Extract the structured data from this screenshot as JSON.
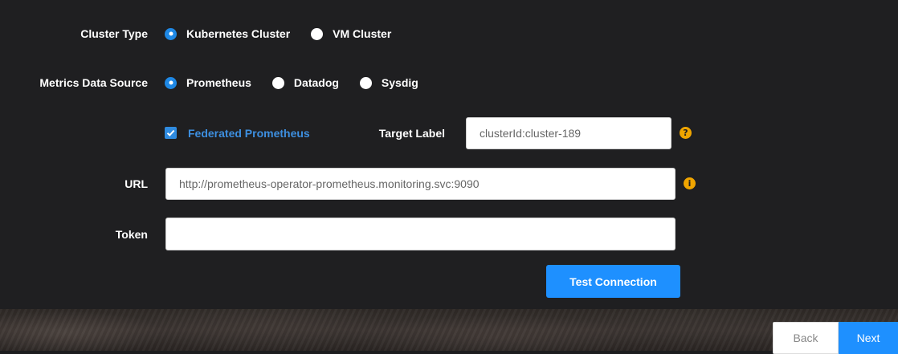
{
  "form": {
    "cluster_type": {
      "label": "Cluster Type",
      "options": [
        {
          "label": "Kubernetes Cluster",
          "selected": true
        },
        {
          "label": "VM Cluster",
          "selected": false
        }
      ]
    },
    "metrics_source": {
      "label": "Metrics Data Source",
      "options": [
        {
          "label": "Prometheus",
          "selected": true
        },
        {
          "label": "Datadog",
          "selected": false
        },
        {
          "label": "Sysdig",
          "selected": false
        }
      ]
    },
    "federated": {
      "label": "Federated Prometheus",
      "checked": true
    },
    "target_label": {
      "label": "Target Label",
      "value": "clusterId:cluster-189"
    },
    "url": {
      "label": "URL",
      "value": "http://prometheus-operator-prometheus.monitoring.svc:9090"
    },
    "token": {
      "label": "Token",
      "value": ""
    },
    "test_button": "Test Connection"
  },
  "icons": {
    "help": "question-circle-icon",
    "info": "info-circle-icon",
    "checkmark": "checkmark-icon"
  },
  "nav": {
    "back": "Back",
    "next": "Next"
  },
  "colors": {
    "accent": "#1e90ff",
    "help_icon": "#f0a500",
    "background": "#1f1f21"
  }
}
